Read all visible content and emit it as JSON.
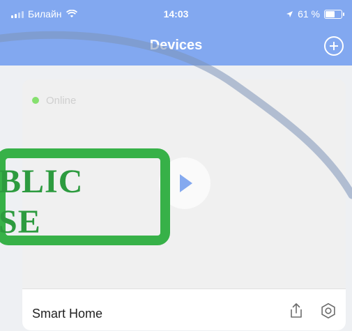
{
  "status_bar": {
    "carrier": "Билайн",
    "time": "14:03",
    "battery": "61 %",
    "battery_level": 0.61
  },
  "header": {
    "title": "Devices"
  },
  "device_card": {
    "status": "Online",
    "name": "Smart Home"
  },
  "stamp": {
    "line1": "BLIC",
    "line2": "SE"
  },
  "colors": {
    "accent": "#82a8f0",
    "online": "#86e06f",
    "stamp": "#37b148"
  },
  "icons": {
    "add": "add-circle-icon",
    "play": "play-icon",
    "share": "share-icon",
    "settings": "settings-hexagon-icon"
  }
}
